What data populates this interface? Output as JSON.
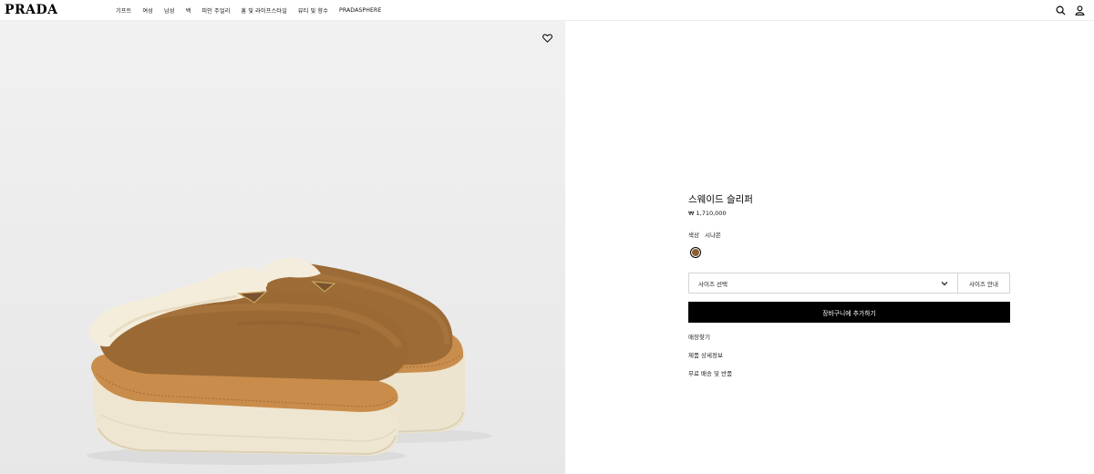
{
  "header": {
    "logo": "PRADA",
    "nav": [
      "기프트",
      "여성",
      "남성",
      "백",
      "피인 주얼리",
      "홈 및 라이프스타일",
      "뷰티 및 향수",
      "PRADASPHERE"
    ]
  },
  "product": {
    "title": "스웨이드 슬리퍼",
    "price": "₩ 1,710,000",
    "color_label": "색상",
    "color_value": "시나몬",
    "swatch_color": "#8a5f33",
    "size_select_label": "사이즈 선택",
    "size_guide_label": "사이즈 안내",
    "add_to_cart_label": "장바구니에 추가하기",
    "links": [
      "매장찾기",
      "제품 상세정보",
      "무료 배송 및 반품"
    ]
  },
  "colors": {
    "brand_black": "#000000",
    "image_bg": "#ececec",
    "suede": "#9a6a36",
    "sole": "#efe6d2"
  },
  "icons": {
    "search": "search-icon",
    "account": "user-icon",
    "wishlist": "heart-icon",
    "dropdown": "chevron-down-icon"
  }
}
